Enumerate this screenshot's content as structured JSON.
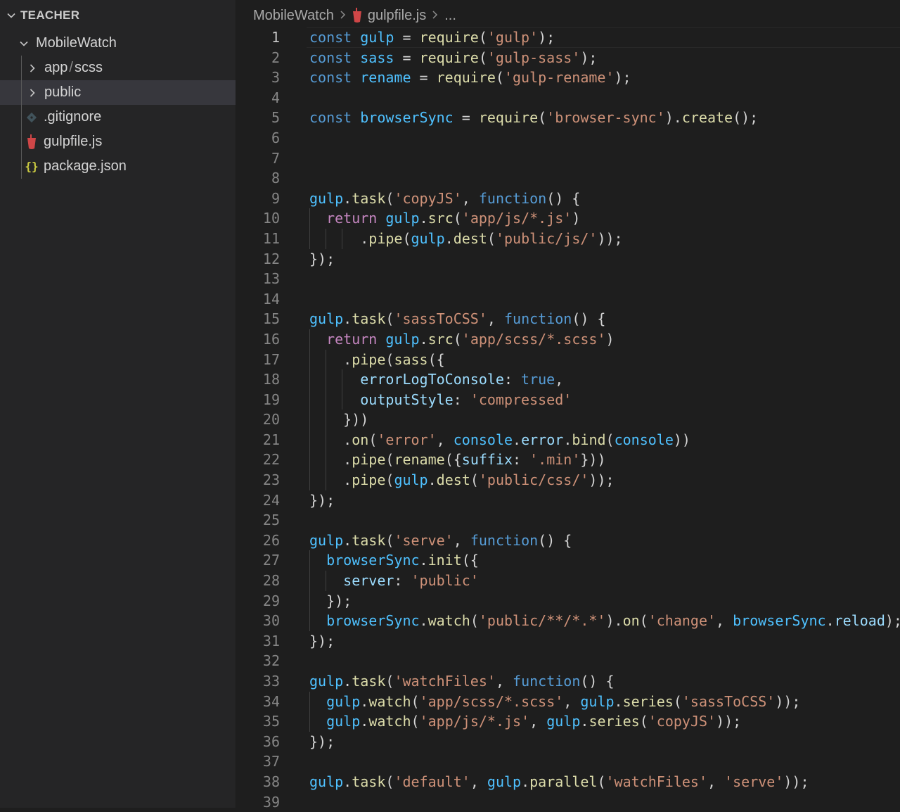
{
  "sidebar": {
    "section_title": "TEACHER",
    "root_folder": "MobileWatch",
    "items": [
      {
        "type": "folder",
        "name": "app",
        "name2": "scss",
        "icon": "chevron-right-icon"
      },
      {
        "type": "folder",
        "name": "public",
        "icon": "chevron-right-icon",
        "selected": true
      },
      {
        "type": "file",
        "name": ".gitignore",
        "icon": "git-file-icon"
      },
      {
        "type": "file",
        "name": "gulpfile.js",
        "icon": "gulp-file-icon"
      },
      {
        "type": "file",
        "name": "package.json",
        "icon": "json-file-icon",
        "glyph": "{}"
      }
    ]
  },
  "breadcrumb": [
    "MobileWatch",
    "gulpfile.js",
    "..."
  ],
  "colors": {
    "keyword": "#569cd6",
    "control": "#c586c0",
    "variable": "#4fc1ff",
    "property": "#9cdcfe",
    "function": "#dcdcaa",
    "string": "#ce9178",
    "text": "#d4d4d4",
    "gulp_icon": "#cf4647"
  },
  "code": {
    "active_line": 1,
    "lines": [
      [
        [
          "kw",
          "const "
        ],
        [
          "var",
          "gulp"
        ],
        [
          "op",
          " = "
        ],
        [
          "fn",
          "require"
        ],
        [
          "p",
          "("
        ],
        [
          "str",
          "'gulp'"
        ],
        [
          "p",
          ");"
        ]
      ],
      [
        [
          "kw",
          "const "
        ],
        [
          "var",
          "sass"
        ],
        [
          "op",
          " = "
        ],
        [
          "fn",
          "require"
        ],
        [
          "p",
          "("
        ],
        [
          "str",
          "'gulp-sass'"
        ],
        [
          "p",
          ");"
        ]
      ],
      [
        [
          "kw",
          "const "
        ],
        [
          "var",
          "rename"
        ],
        [
          "op",
          " = "
        ],
        [
          "fn",
          "require"
        ],
        [
          "p",
          "("
        ],
        [
          "str",
          "'gulp-rename'"
        ],
        [
          "p",
          ");"
        ]
      ],
      [],
      [
        [
          "kw",
          "const "
        ],
        [
          "var",
          "browserSync"
        ],
        [
          "op",
          " = "
        ],
        [
          "fn",
          "require"
        ],
        [
          "p",
          "("
        ],
        [
          "str",
          "'browser-sync'"
        ],
        [
          "p",
          ")."
        ],
        [
          "fn",
          "create"
        ],
        [
          "p",
          "();"
        ]
      ],
      [],
      [],
      [],
      [
        [
          "var",
          "gulp"
        ],
        [
          "p",
          "."
        ],
        [
          "fn",
          "task"
        ],
        [
          "p",
          "("
        ],
        [
          "str",
          "'copyJS'"
        ],
        [
          "p",
          ", "
        ],
        [
          "kw",
          "function"
        ],
        [
          "p",
          "() {"
        ]
      ],
      [
        [
          "p",
          "  "
        ],
        [
          "ctl",
          "return "
        ],
        [
          "var",
          "gulp"
        ],
        [
          "p",
          "."
        ],
        [
          "fn",
          "src"
        ],
        [
          "p",
          "("
        ],
        [
          "str",
          "'app/js/*.js'"
        ],
        [
          "p",
          ")"
        ]
      ],
      [
        [
          "p",
          "      ."
        ],
        [
          "fn",
          "pipe"
        ],
        [
          "p",
          "("
        ],
        [
          "var",
          "gulp"
        ],
        [
          "p",
          "."
        ],
        [
          "fn",
          "dest"
        ],
        [
          "p",
          "("
        ],
        [
          "str",
          "'public/js/'"
        ],
        [
          "p",
          "));"
        ]
      ],
      [
        [
          "p",
          "});"
        ]
      ],
      [],
      [],
      [
        [
          "var",
          "gulp"
        ],
        [
          "p",
          "."
        ],
        [
          "fn",
          "task"
        ],
        [
          "p",
          "("
        ],
        [
          "str",
          "'sassToCSS'"
        ],
        [
          "p",
          ", "
        ],
        [
          "kw",
          "function"
        ],
        [
          "p",
          "() {"
        ]
      ],
      [
        [
          "p",
          "  "
        ],
        [
          "ctl",
          "return "
        ],
        [
          "var",
          "gulp"
        ],
        [
          "p",
          "."
        ],
        [
          "fn",
          "src"
        ],
        [
          "p",
          "("
        ],
        [
          "str",
          "'app/scss/*.scss'"
        ],
        [
          "p",
          ")"
        ]
      ],
      [
        [
          "p",
          "    ."
        ],
        [
          "fn",
          "pipe"
        ],
        [
          "p",
          "("
        ],
        [
          "fn",
          "sass"
        ],
        [
          "p",
          "({"
        ]
      ],
      [
        [
          "p",
          "      "
        ],
        [
          "prop",
          "errorLogToConsole"
        ],
        [
          "p",
          ": "
        ],
        [
          "bool",
          "true"
        ],
        [
          "p",
          ","
        ]
      ],
      [
        [
          "p",
          "      "
        ],
        [
          "prop",
          "outputStyle"
        ],
        [
          "p",
          ": "
        ],
        [
          "str",
          "'compressed'"
        ]
      ],
      [
        [
          "p",
          "    }))"
        ]
      ],
      [
        [
          "p",
          "    ."
        ],
        [
          "fn",
          "on"
        ],
        [
          "p",
          "("
        ],
        [
          "str",
          "'error'"
        ],
        [
          "p",
          ", "
        ],
        [
          "var",
          "console"
        ],
        [
          "p",
          "."
        ],
        [
          "prop",
          "error"
        ],
        [
          "p",
          "."
        ],
        [
          "fn",
          "bind"
        ],
        [
          "p",
          "("
        ],
        [
          "var",
          "console"
        ],
        [
          "p",
          "))"
        ]
      ],
      [
        [
          "p",
          "    ."
        ],
        [
          "fn",
          "pipe"
        ],
        [
          "p",
          "("
        ],
        [
          "fn",
          "rename"
        ],
        [
          "p",
          "({"
        ],
        [
          "prop",
          "suffix"
        ],
        [
          "p",
          ": "
        ],
        [
          "str",
          "'.min'"
        ],
        [
          "p",
          "}))"
        ]
      ],
      [
        [
          "p",
          "    ."
        ],
        [
          "fn",
          "pipe"
        ],
        [
          "p",
          "("
        ],
        [
          "var",
          "gulp"
        ],
        [
          "p",
          "."
        ],
        [
          "fn",
          "dest"
        ],
        [
          "p",
          "("
        ],
        [
          "str",
          "'public/css/'"
        ],
        [
          "p",
          "));"
        ]
      ],
      [
        [
          "p",
          "});"
        ]
      ],
      [],
      [
        [
          "var",
          "gulp"
        ],
        [
          "p",
          "."
        ],
        [
          "fn",
          "task"
        ],
        [
          "p",
          "("
        ],
        [
          "str",
          "'serve'"
        ],
        [
          "p",
          ", "
        ],
        [
          "kw",
          "function"
        ],
        [
          "p",
          "() {"
        ]
      ],
      [
        [
          "p",
          "  "
        ],
        [
          "var",
          "browserSync"
        ],
        [
          "p",
          "."
        ],
        [
          "fn",
          "init"
        ],
        [
          "p",
          "({"
        ]
      ],
      [
        [
          "p",
          "    "
        ],
        [
          "prop",
          "server"
        ],
        [
          "p",
          ": "
        ],
        [
          "str",
          "'public'"
        ]
      ],
      [
        [
          "p",
          "  });"
        ]
      ],
      [
        [
          "p",
          "  "
        ],
        [
          "var",
          "browserSync"
        ],
        [
          "p",
          "."
        ],
        [
          "fn",
          "watch"
        ],
        [
          "p",
          "("
        ],
        [
          "str",
          "'public/**/*.*'"
        ],
        [
          "p",
          ")."
        ],
        [
          "fn",
          "on"
        ],
        [
          "p",
          "("
        ],
        [
          "str",
          "'change'"
        ],
        [
          "p",
          ", "
        ],
        [
          "var",
          "browserSync"
        ],
        [
          "p",
          "."
        ],
        [
          "prop",
          "reload"
        ],
        [
          "p",
          ");"
        ]
      ],
      [
        [
          "p",
          "});"
        ]
      ],
      [],
      [
        [
          "var",
          "gulp"
        ],
        [
          "p",
          "."
        ],
        [
          "fn",
          "task"
        ],
        [
          "p",
          "("
        ],
        [
          "str",
          "'watchFiles'"
        ],
        [
          "p",
          ", "
        ],
        [
          "kw",
          "function"
        ],
        [
          "p",
          "() {"
        ]
      ],
      [
        [
          "p",
          "  "
        ],
        [
          "var",
          "gulp"
        ],
        [
          "p",
          "."
        ],
        [
          "fn",
          "watch"
        ],
        [
          "p",
          "("
        ],
        [
          "str",
          "'app/scss/*.scss'"
        ],
        [
          "p",
          ", "
        ],
        [
          "var",
          "gulp"
        ],
        [
          "p",
          "."
        ],
        [
          "fn",
          "series"
        ],
        [
          "p",
          "("
        ],
        [
          "str",
          "'sassToCSS'"
        ],
        [
          "p",
          "));"
        ]
      ],
      [
        [
          "p",
          "  "
        ],
        [
          "var",
          "gulp"
        ],
        [
          "p",
          "."
        ],
        [
          "fn",
          "watch"
        ],
        [
          "p",
          "("
        ],
        [
          "str",
          "'app/js/*.js'"
        ],
        [
          "p",
          ", "
        ],
        [
          "var",
          "gulp"
        ],
        [
          "p",
          "."
        ],
        [
          "fn",
          "series"
        ],
        [
          "p",
          "("
        ],
        [
          "str",
          "'copyJS'"
        ],
        [
          "p",
          "));"
        ]
      ],
      [
        [
          "p",
          "});"
        ]
      ],
      [],
      [
        [
          "var",
          "gulp"
        ],
        [
          "p",
          "."
        ],
        [
          "fn",
          "task"
        ],
        [
          "p",
          "("
        ],
        [
          "str",
          "'default'"
        ],
        [
          "p",
          ", "
        ],
        [
          "var",
          "gulp"
        ],
        [
          "p",
          "."
        ],
        [
          "fn",
          "parallel"
        ],
        [
          "p",
          "("
        ],
        [
          "str",
          "'watchFiles'"
        ],
        [
          "p",
          ", "
        ],
        [
          "str",
          "'serve'"
        ],
        [
          "p",
          "));"
        ]
      ],
      []
    ]
  }
}
